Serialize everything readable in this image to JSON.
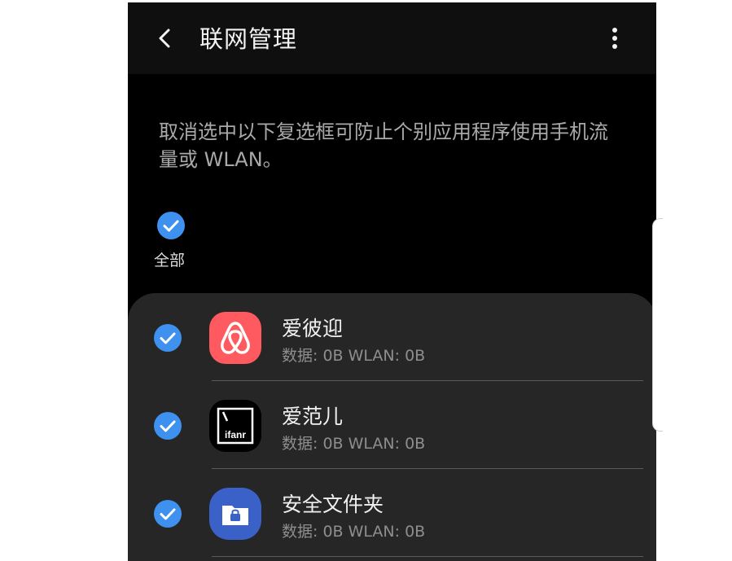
{
  "header": {
    "title": "联网管理",
    "back_icon": "chevron-left-icon",
    "more_icon": "more-vertical-icon"
  },
  "description": "取消选中以下复选框可防止个别应用程序使用手机流量或 WLAN。",
  "select_all": {
    "label": "全部",
    "checked": true
  },
  "apps": [
    {
      "name": "爱彼迎",
      "usage": "数据: 0B  WLAN: 0B",
      "checked": true,
      "icon": "airbnb-icon"
    },
    {
      "name": "爱范儿",
      "usage": "数据: 0B  WLAN: 0B",
      "checked": true,
      "icon": "ifanr-icon",
      "icon_text": "ifanr"
    },
    {
      "name": "安全文件夹",
      "usage": "数据: 0B  WLAN: 0B",
      "checked": true,
      "icon": "secure-folder-icon"
    }
  ],
  "colors": {
    "background": "#000000",
    "appbar": "#0f0f0f",
    "list_background": "#262626",
    "check_blue": "#3e91ee",
    "airbnb": "#ff5a5f",
    "secure_folder": "#3a61c8"
  }
}
